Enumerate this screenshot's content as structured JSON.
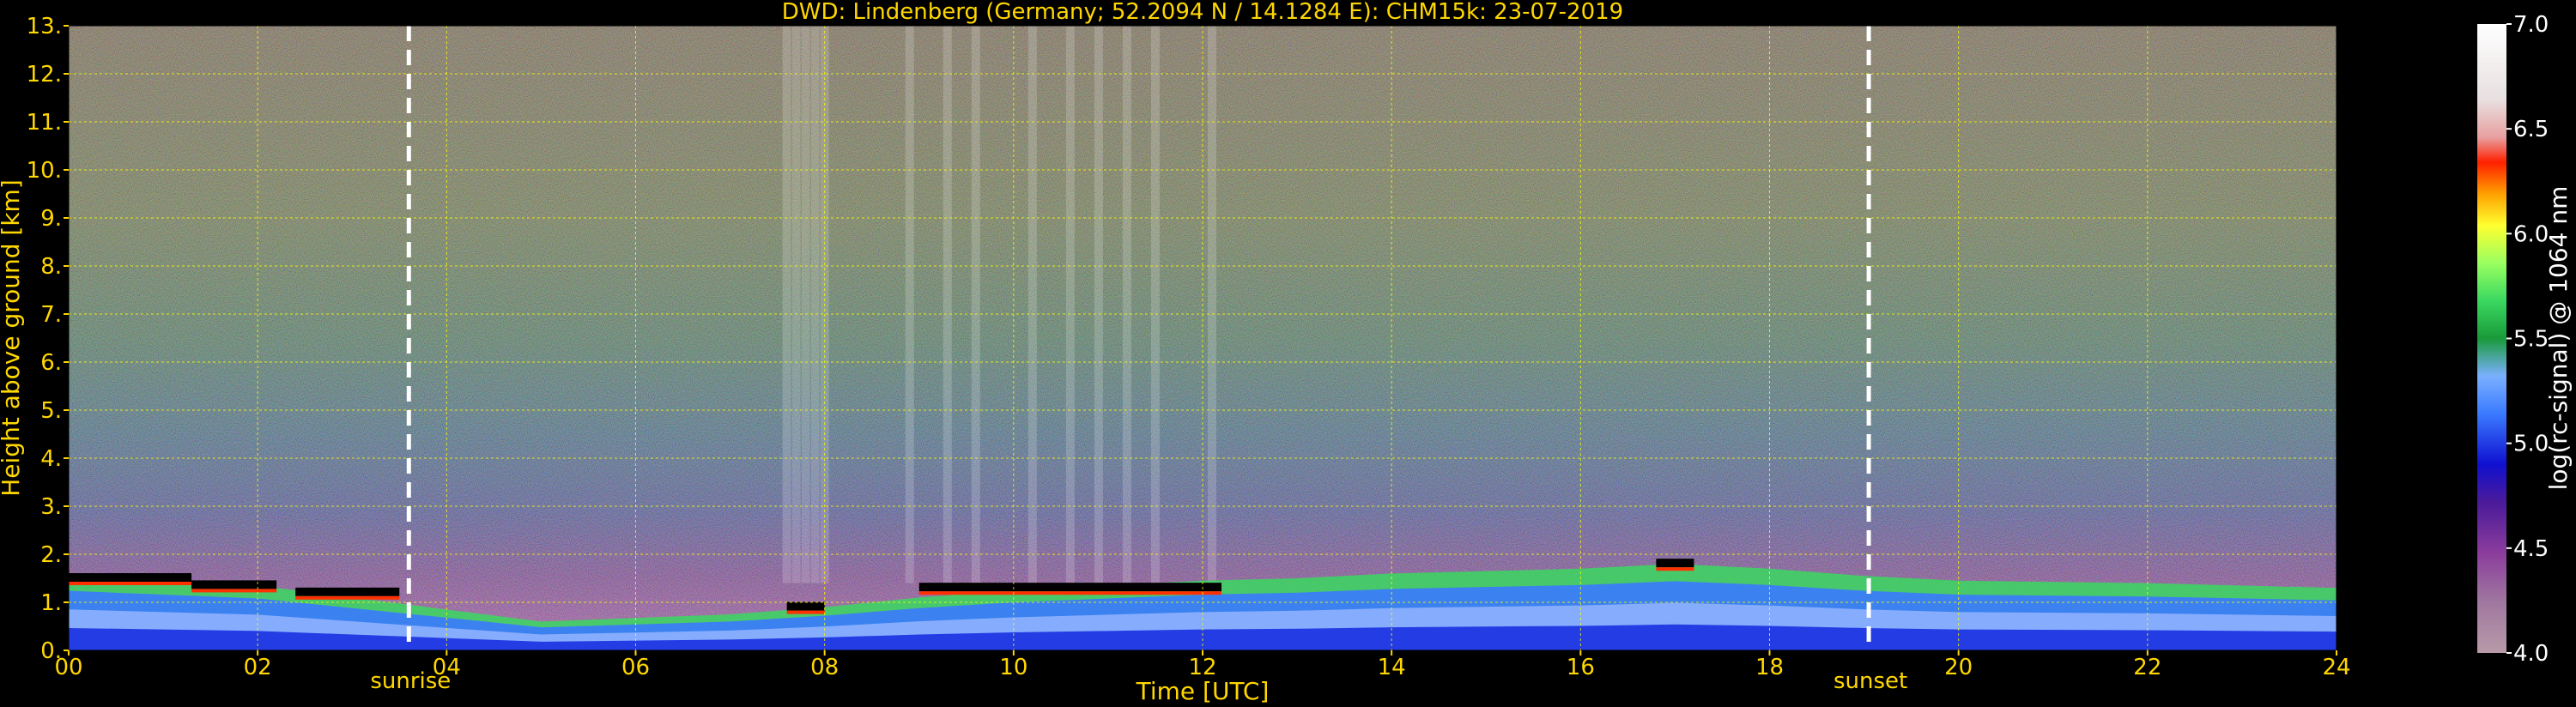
{
  "title": "DWD: Lindenberg (Germany; 52.2094 N / 14.1284 E):    CHM15k: 23-07-2019",
  "chart_data": {
    "type": "heatmap",
    "title": "DWD: Lindenberg (Germany; 52.2094 N / 14.1284 E):    CHM15k: 23-07-2019",
    "xlabel": "Time [UTC]",
    "ylabel": "Height above ground [km]",
    "xlim": [
      0,
      24
    ],
    "ylim": [
      0,
      13
    ],
    "x_ticks": [
      0,
      2,
      4,
      6,
      8,
      10,
      12,
      14,
      16,
      18,
      20,
      22,
      24
    ],
    "x_tick_labels": [
      "00",
      "02",
      "04",
      "06",
      "08",
      "10",
      "12",
      "14",
      "16",
      "18",
      "20",
      "22",
      "24"
    ],
    "y_ticks": [
      0,
      1,
      2,
      3,
      4,
      5,
      6,
      7,
      8,
      9,
      10,
      11,
      12,
      13
    ],
    "y_tick_labels": [
      "0.",
      "1.",
      "2.",
      "3.",
      "4.",
      "5.",
      "6.",
      "7.",
      "8.",
      "9.",
      "10.",
      "11.",
      "12.",
      "13."
    ],
    "grid": true,
    "annotations": [
      {
        "label": "sunrise",
        "x": 3.6
      },
      {
        "label": "sunset",
        "x": 19.05
      }
    ],
    "colorbar": {
      "label": "log(rc-signal) @ 1064 nm",
      "range": [
        4.0,
        7.0
      ],
      "ticks": [
        4.0,
        4.5,
        5.0,
        5.5,
        6.0,
        6.5,
        7.0
      ],
      "tick_labels": [
        "4.0",
        "4.5",
        "5.0",
        "5.5",
        "6.0",
        "6.5",
        "7.0"
      ]
    },
    "features": {
      "boundary_layer_top": [
        {
          "x": 0.0,
          "y": 1.55
        },
        {
          "x": 1.0,
          "y": 1.45
        },
        {
          "x": 2.0,
          "y": 1.35
        },
        {
          "x": 3.0,
          "y": 1.1
        },
        {
          "x": 3.6,
          "y": 0.95
        },
        {
          "x": 5.0,
          "y": 0.6
        },
        {
          "x": 7.0,
          "y": 0.75
        },
        {
          "x": 8.0,
          "y": 0.9
        },
        {
          "x": 9.0,
          "y": 1.1
        },
        {
          "x": 10.0,
          "y": 1.25
        },
        {
          "x": 11.0,
          "y": 1.35
        },
        {
          "x": 12.0,
          "y": 1.45
        },
        {
          "x": 13.0,
          "y": 1.5
        },
        {
          "x": 14.0,
          "y": 1.6
        },
        {
          "x": 16.0,
          "y": 1.7
        },
        {
          "x": 17.0,
          "y": 1.8
        },
        {
          "x": 18.0,
          "y": 1.7
        },
        {
          "x": 19.0,
          "y": 1.55
        },
        {
          "x": 20.0,
          "y": 1.45
        },
        {
          "x": 22.0,
          "y": 1.4
        },
        {
          "x": 24.0,
          "y": 1.3
        }
      ],
      "cloud_bases": [
        {
          "x0": 0.0,
          "x1": 1.3,
          "y": 1.5
        },
        {
          "x0": 1.3,
          "x1": 2.2,
          "y": 1.35
        },
        {
          "x0": 2.4,
          "x1": 3.5,
          "y": 1.2
        },
        {
          "x0": 7.6,
          "x1": 8.0,
          "y": 0.9
        },
        {
          "x0": 9.0,
          "x1": 12.2,
          "y": 1.3
        },
        {
          "x0": 16.8,
          "x1": 17.2,
          "y": 1.8
        }
      ],
      "precipitation_streaks": [
        7.6,
        7.7,
        7.8,
        7.9,
        8.0,
        8.9,
        9.3,
        9.6,
        10.2,
        10.6,
        10.9,
        11.2,
        11.5,
        12.1
      ]
    }
  }
}
